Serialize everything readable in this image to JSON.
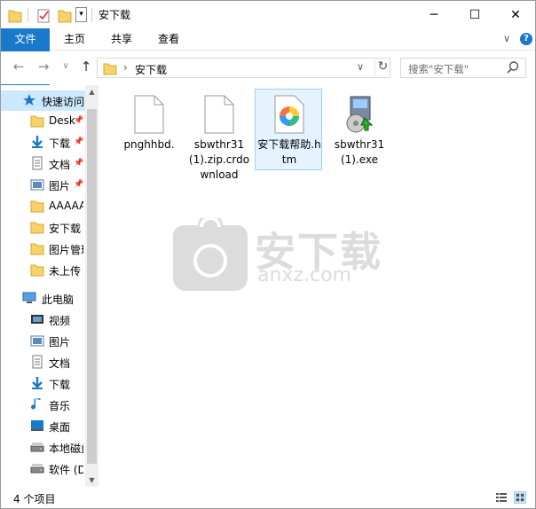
{
  "window": {
    "title": "安下载",
    "controls": {
      "minimize": "─",
      "maximize": "☐",
      "close": "✕"
    }
  },
  "ribbon": {
    "tabs": [
      {
        "label": "文件"
      },
      {
        "label": "主页"
      },
      {
        "label": "共享"
      },
      {
        "label": "查看"
      }
    ],
    "collapse_glyph": "∨",
    "help_glyph": "?"
  },
  "navigation": {
    "back_glyph": "←",
    "forward_glyph": "→",
    "recent_glyph": "∨",
    "up_glyph": "↑",
    "address": {
      "path": "安下载",
      "separator": "›",
      "dropdown": "∨",
      "refresh": "↻"
    },
    "search": {
      "placeholder": "搜索\"安下载\""
    }
  },
  "sidebar": {
    "scroll_up": "▲",
    "scroll_down": "▼",
    "items": [
      {
        "label": "快速访问",
        "icon": "star-icon",
        "selected": true
      },
      {
        "label": "Desk",
        "icon": "folder-icon",
        "pinned": true
      },
      {
        "label": "下载",
        "icon": "download-icon",
        "pinned": true
      },
      {
        "label": "文档",
        "icon": "document-icon",
        "pinned": true
      },
      {
        "label": "图片",
        "icon": "picture-icon",
        "pinned": true
      },
      {
        "label": "AAAAA",
        "icon": "folder-icon"
      },
      {
        "label": "安下载",
        "icon": "folder-icon"
      },
      {
        "label": "图片管理",
        "icon": "folder-icon"
      },
      {
        "label": "未上传",
        "icon": "folder-icon"
      },
      {
        "label": "此电脑",
        "icon": "computer-icon"
      },
      {
        "label": "视频",
        "icon": "video-icon"
      },
      {
        "label": "图片",
        "icon": "picture-icon"
      },
      {
        "label": "文档",
        "icon": "document-icon"
      },
      {
        "label": "下载",
        "icon": "download-icon"
      },
      {
        "label": "音乐",
        "icon": "music-icon"
      },
      {
        "label": "桌面",
        "icon": "desktop-icon"
      },
      {
        "label": "本地磁盘",
        "icon": "drive-icon"
      },
      {
        "label": "软件 (D",
        "icon": "drive-icon"
      }
    ]
  },
  "files": [
    {
      "name": "pnghhbd.",
      "icon": "blank-file-icon",
      "selected": false
    },
    {
      "name": "sbwthr31 (1).zip.crdownload",
      "icon": "blank-file-icon",
      "selected": false
    },
    {
      "name": "安下载帮助.htm",
      "icon": "htm-file-icon",
      "selected": true
    },
    {
      "name": "sbwthr31 (1).exe",
      "icon": "installer-icon",
      "selected": false
    }
  ],
  "watermark": {
    "cn": "安下载",
    "en": "anxz.com"
  },
  "status": {
    "count": "4 个项目"
  },
  "colors": {
    "accent": "#1979ca",
    "selection": "#cce8ff",
    "folder": "#f7d26a"
  }
}
